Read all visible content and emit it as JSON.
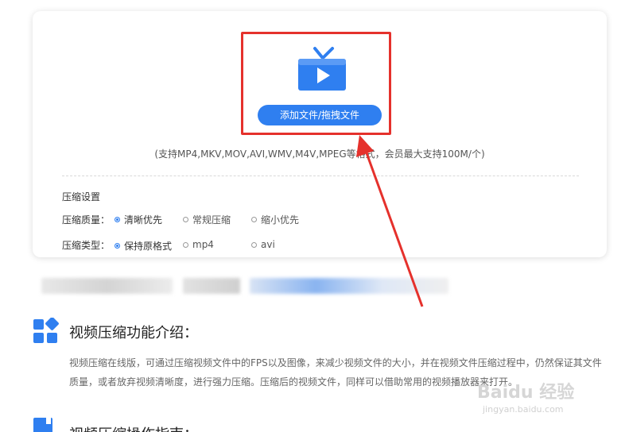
{
  "upload": {
    "button_label": "添加文件/拖拽文件",
    "formats_note": "(支持MP4,MKV,MOV,AVI,WMV,M4V,MPEG等格式，会员最大支持100M/个)"
  },
  "settings": {
    "title": "压缩设置",
    "quality": {
      "label": "压缩质量：",
      "options": [
        "清晰优先",
        "常规压缩",
        "缩小优先"
      ],
      "selected": "清晰优先"
    },
    "type": {
      "label": "压缩类型：",
      "options": [
        "保持原格式",
        "mp4",
        "avi"
      ],
      "selected": "保持原格式"
    }
  },
  "intro": {
    "title": "视频压缩功能介绍：",
    "body": "视频压缩在线版，可通过压缩视频文件中的FPS以及图像，来减少视频文件的大小，并在视频文件压缩过程中，仍然保证其文件质量，或者放弃视频清晰度，进行强力压缩。压缩后的视频文件，同样可以借助常用的视频播放器来打开。"
  },
  "guide": {
    "title": "视频压缩操作指南："
  },
  "watermark": {
    "brand": "Baidu 经验",
    "url": "jingyan.baidu.com"
  },
  "colors": {
    "accent": "#2f7ff0",
    "highlight_box": "#e5312c"
  }
}
